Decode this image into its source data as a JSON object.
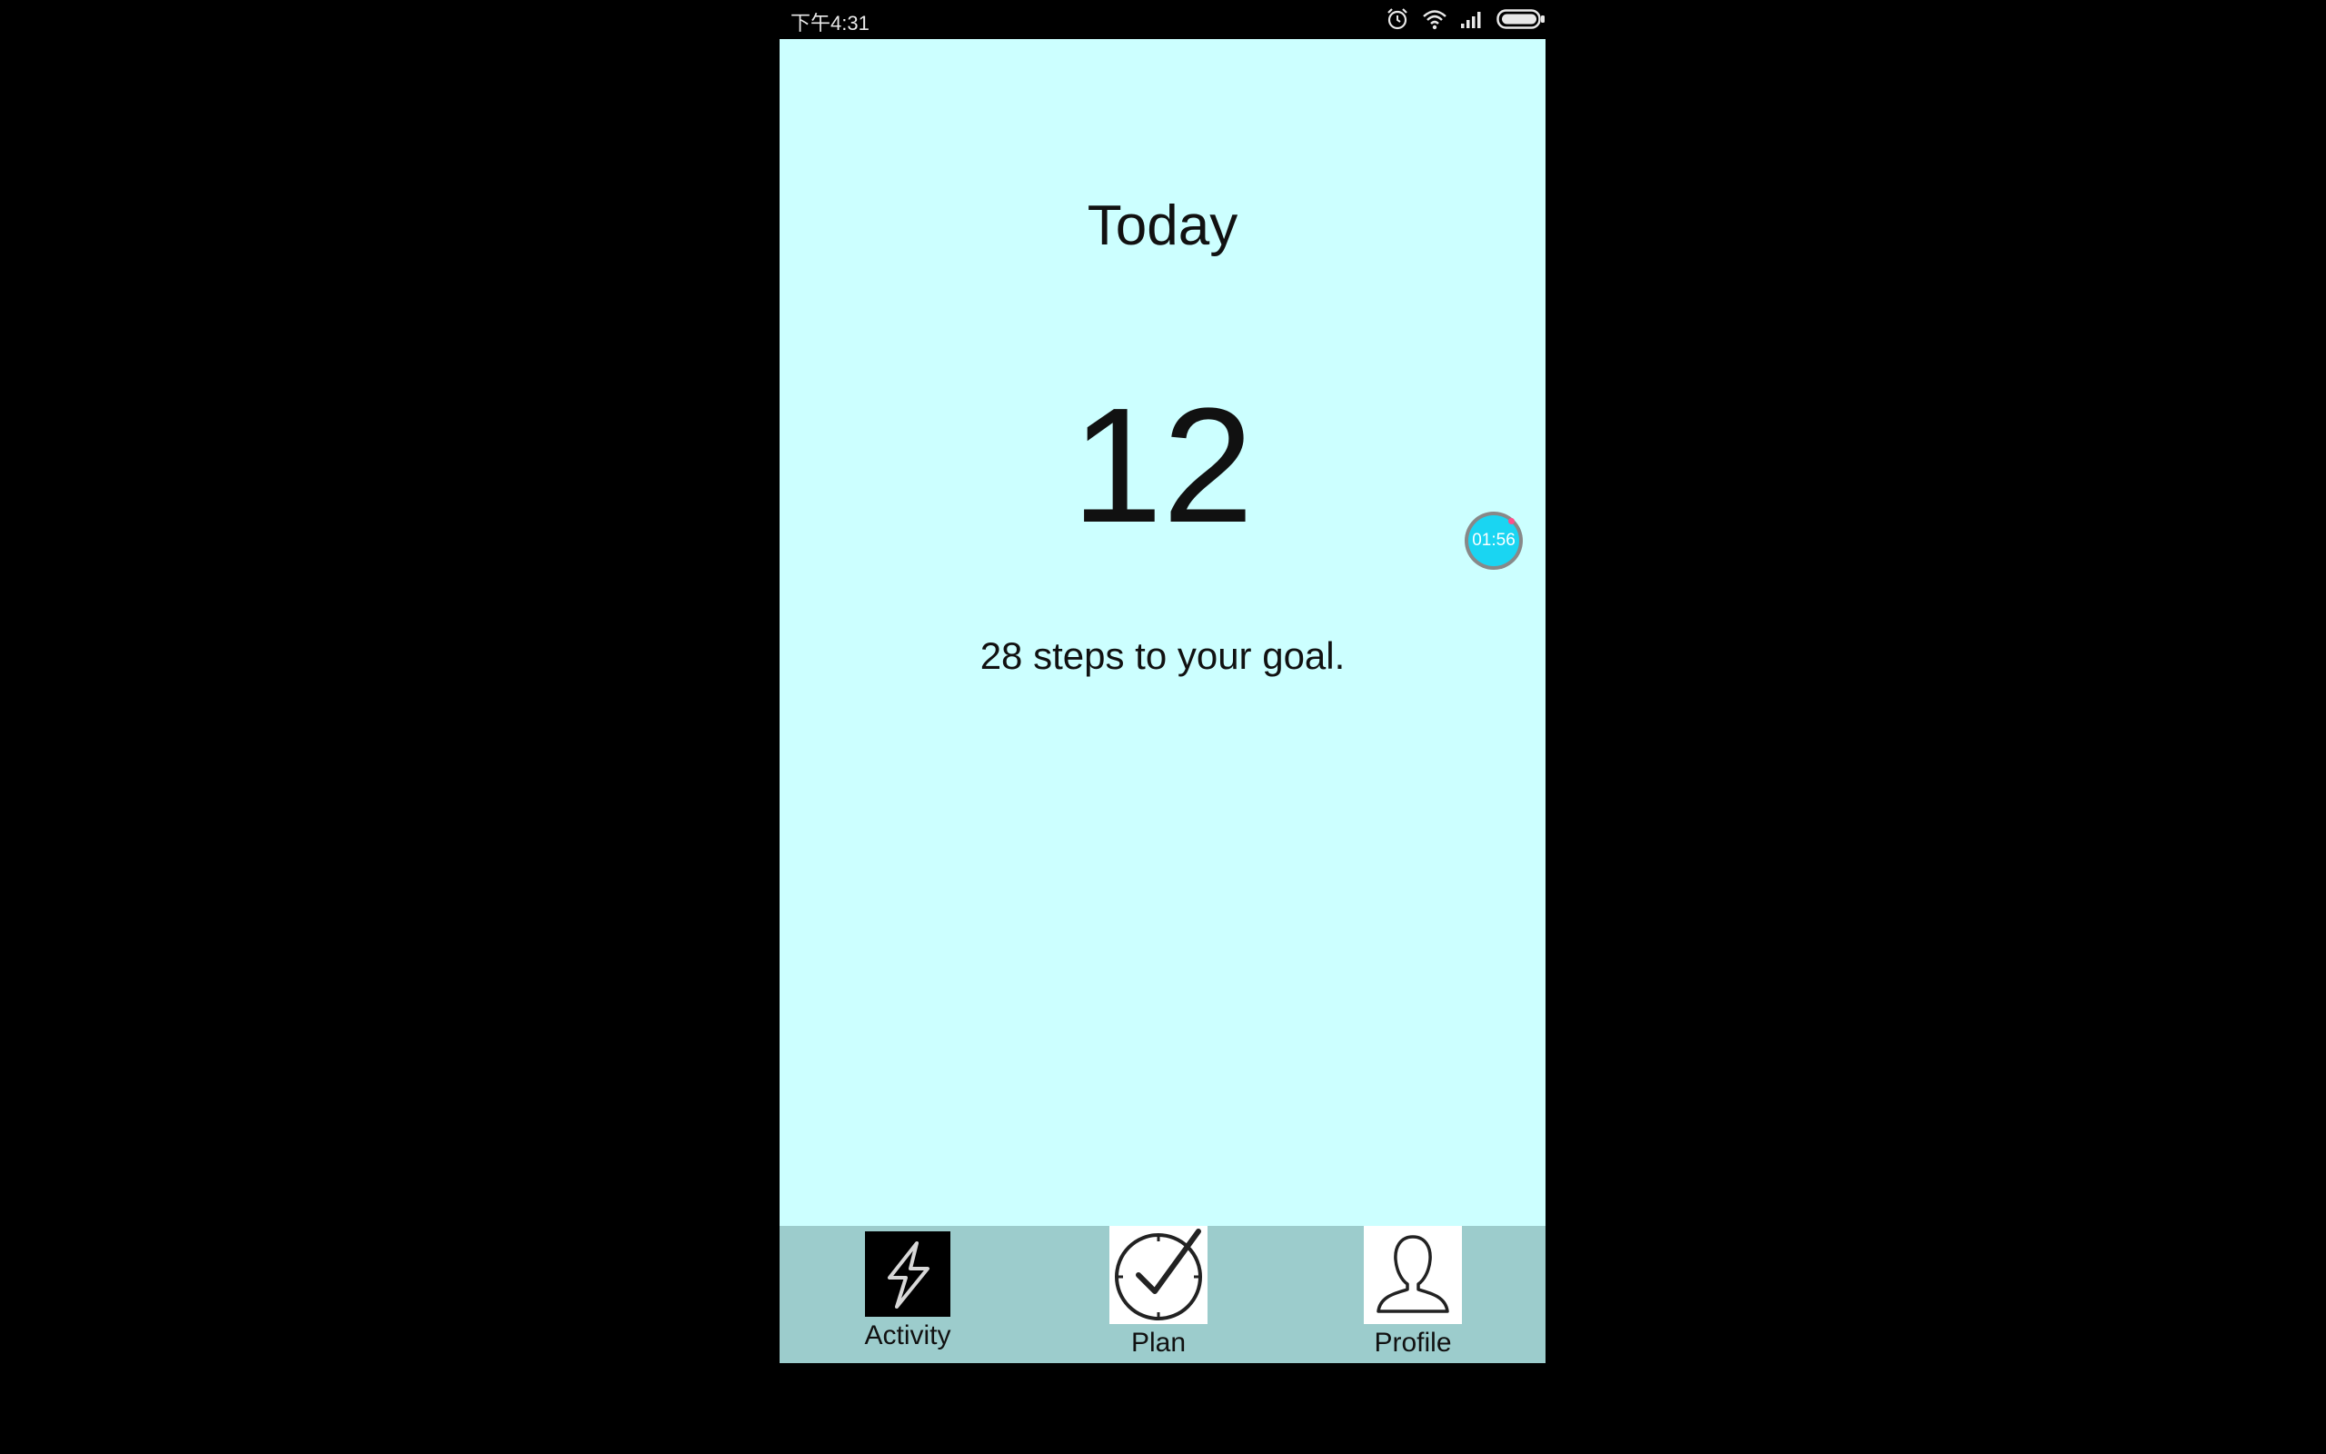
{
  "status_bar": {
    "time": "下午4:31",
    "icons": [
      "alarm-icon",
      "wifi-icon",
      "signal-icon",
      "battery-icon"
    ]
  },
  "main": {
    "title": "Today",
    "step_count": "12",
    "goal_message": "28 steps to your goal."
  },
  "floating_timer": {
    "time": "01:56",
    "color": "#1ad5f2"
  },
  "tab_bar": {
    "items": [
      {
        "label": "Activity",
        "icon": "lightning-icon"
      },
      {
        "label": "Plan",
        "icon": "clock-check-icon"
      },
      {
        "label": "Profile",
        "icon": "person-icon"
      }
    ]
  },
  "colors": {
    "background": "#ccffff",
    "tab_bar": "#9ccccc",
    "outer": "#000000"
  }
}
